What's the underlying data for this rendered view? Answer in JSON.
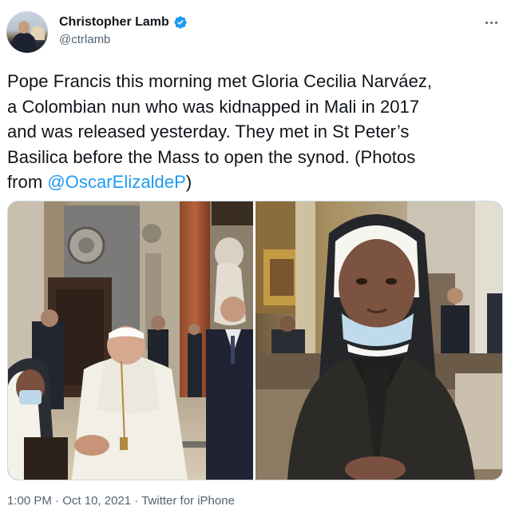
{
  "author": {
    "display_name": "Christopher Lamb",
    "handle": "@ctrlamb",
    "verified": true,
    "avatar_icon": "avatar-photo"
  },
  "tweet": {
    "text_lines": [
      "Pope Francis this morning met Gloria Cecilia Narváez,",
      "a Colombian nun who was kidnapped in Mali in 2017",
      "and was released yesterday. They met in St Peter’s",
      "Basilica before the Mass to open the synod. (Photos",
      "from "
    ],
    "mention": "@OscarElizaldeP",
    "closing": ")"
  },
  "media": {
    "count": 2,
    "photos": [
      "photo-pope-meeting-nun",
      "photo-nun-portrait"
    ]
  },
  "meta": {
    "time": "1:00 PM",
    "separator": " · ",
    "date": "Oct 10, 2021",
    "source": "Twitter for iPhone"
  },
  "colors": {
    "accent": "#1d9bf0",
    "text": "#0f1419",
    "secondary": "#536471",
    "border": "#cfd9de"
  }
}
